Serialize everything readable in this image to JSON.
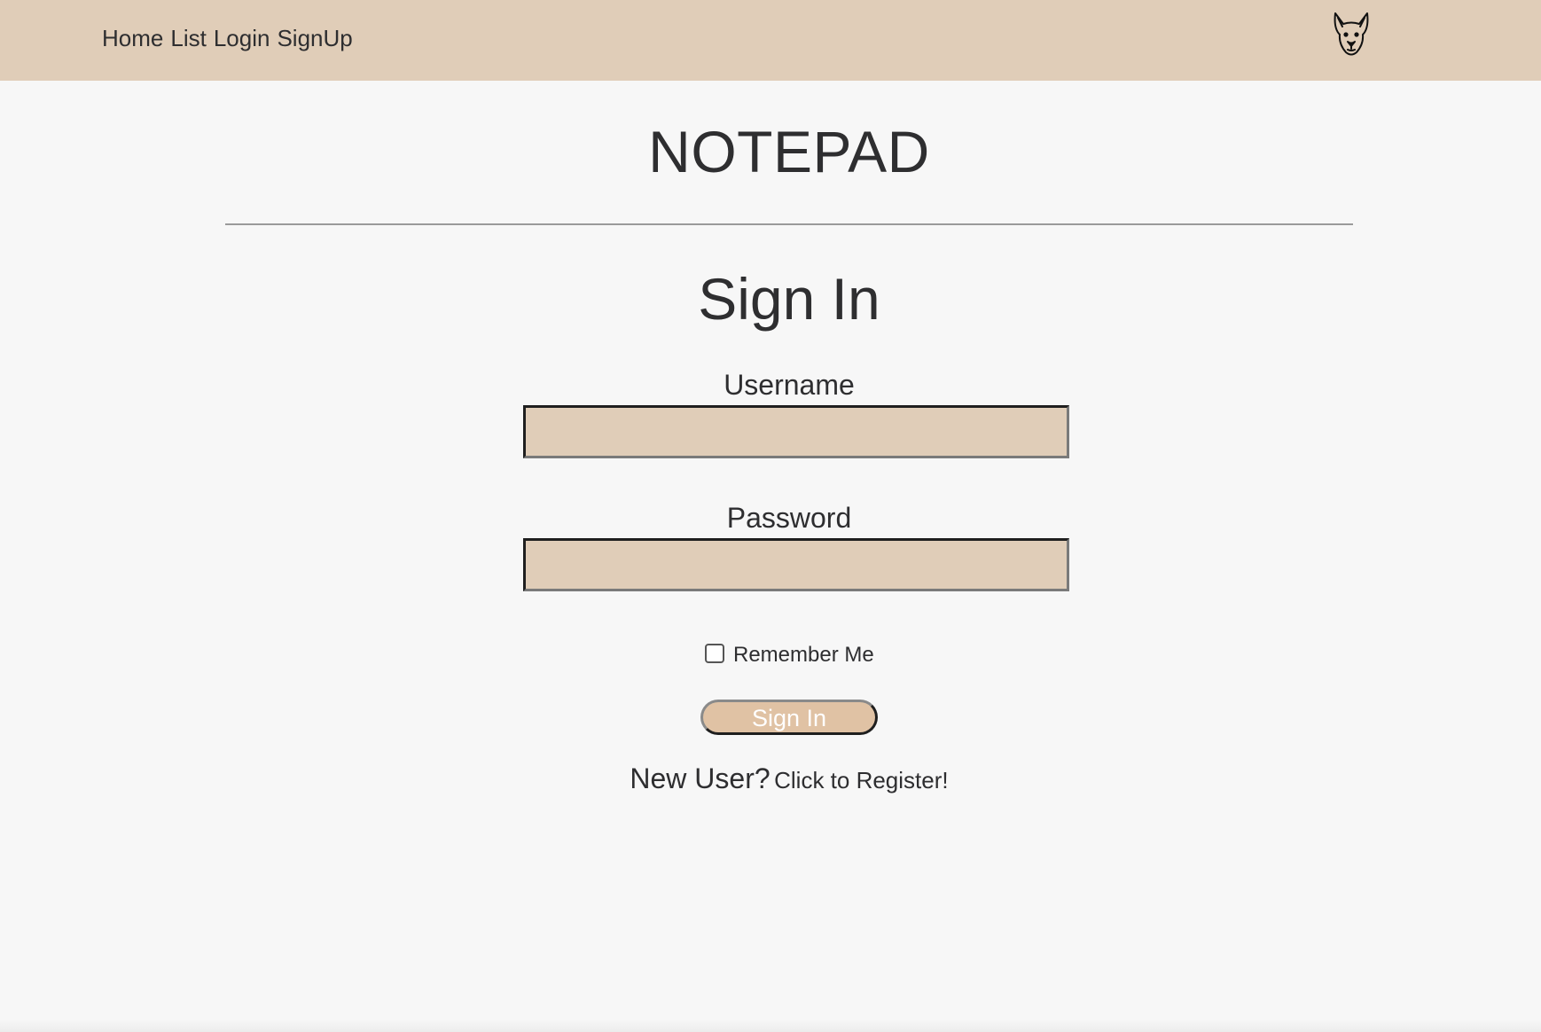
{
  "nav": {
    "items": [
      {
        "label": "Home"
      },
      {
        "label": "List"
      },
      {
        "label": "Login"
      },
      {
        "label": "SignUp"
      }
    ],
    "logo_icon": "dog-face-icon"
  },
  "app": {
    "title": "NOTEPAD"
  },
  "form": {
    "heading": "Sign In",
    "username": {
      "label": "Username",
      "value": "",
      "placeholder": ""
    },
    "password": {
      "label": "Password",
      "value": "",
      "placeholder": ""
    },
    "remember": {
      "label": "Remember Me",
      "checked": false
    },
    "submit_label": "Sign In",
    "new_user_text": "New User?",
    "register_link": "Click to Register!"
  },
  "colors": {
    "header_bg": "#e0cdb8",
    "page_bg": "#f7f7f7",
    "input_bg": "#e0cdb8",
    "button_bg": "#e0c2a4",
    "text": "#2e2e30"
  }
}
